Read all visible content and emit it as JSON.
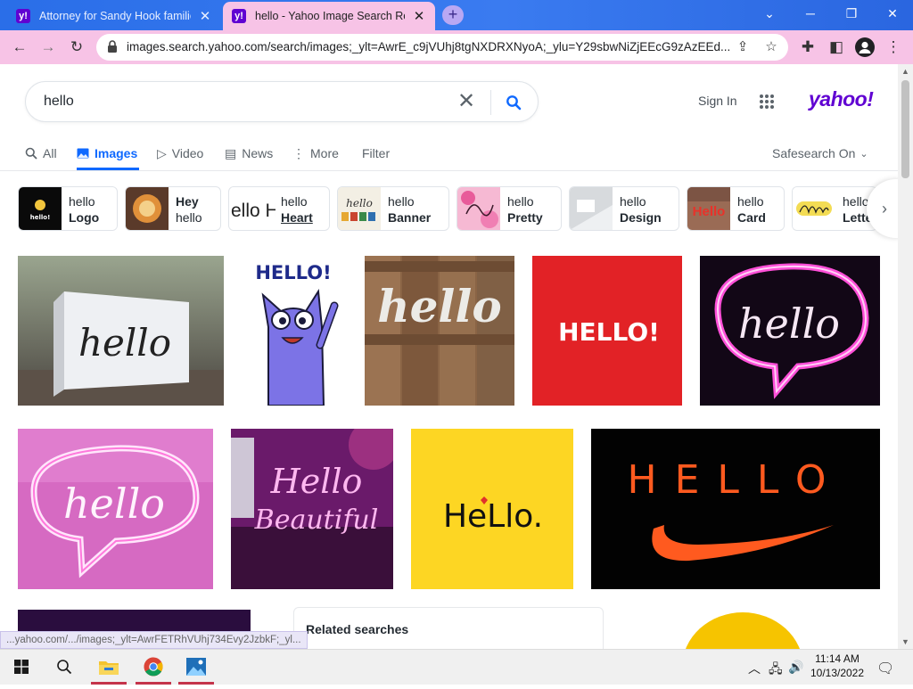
{
  "browser": {
    "tabs": [
      {
        "title": "Attorney for Sandy Hook familie",
        "active": false
      },
      {
        "title": "hello - Yahoo Image Search Resu",
        "active": true
      }
    ],
    "favicon_letter": "y!",
    "new_tab": "+",
    "address": "images.search.yahoo.com/search/images;_ylt=AwrE_c9jVUhj8tgNXDRXNyoA;_ylu=Y29sbwNiZjEEcG9zAzEEd...",
    "status_url": "...yahoo.com/.../images;_ylt=AwrFETRhVUhj734Evy2JzbkF;_yl..."
  },
  "header": {
    "query": "hello",
    "sign_in": "Sign In",
    "logo": "yahoo!",
    "safesearch": "Safesearch On",
    "filter": "Filter"
  },
  "vertical_tabs": [
    {
      "label": "All",
      "icon": "search-icon"
    },
    {
      "label": "Images",
      "icon": "image-icon"
    },
    {
      "label": "Video",
      "icon": "play-icon"
    },
    {
      "label": "News",
      "icon": "news-icon"
    },
    {
      "label": "More",
      "icon": "more-icon"
    }
  ],
  "chips": [
    {
      "line1": "hello",
      "line2": "Logo"
    },
    {
      "line1": "Hey",
      "line2": "hello"
    },
    {
      "line1": "hello",
      "line2": "Heart"
    },
    {
      "line1": "hello",
      "line2": "Banner"
    },
    {
      "line1": "hello",
      "line2": "Pretty"
    },
    {
      "line1": "hello",
      "line2": "Design"
    },
    {
      "line1": "hello",
      "line2": "Card"
    },
    {
      "line1": "hello",
      "line2": "Letter"
    }
  ],
  "image_texts": {
    "cat": "HELLO!",
    "wood": "hello",
    "red": "HELLO!",
    "neon1": "hello",
    "neon2": "hello",
    "beautiful1": "Hello",
    "beautiful2": "Beautiful",
    "yellow": "HeLlo.",
    "orange": "HELLO",
    "block": "hello",
    "chip_logo": "hello!",
    "chip_heart": "ello H",
    "chip_banner": "hello",
    "chip_card": "Hello"
  },
  "related": {
    "heading": "Related searches"
  },
  "taskbar": {
    "time": "11:14 AM",
    "date": "10/13/2022"
  },
  "colors": {
    "brand": "#6001d2",
    "accent": "#0f69ff",
    "tab_active": "#f7c3e6"
  }
}
